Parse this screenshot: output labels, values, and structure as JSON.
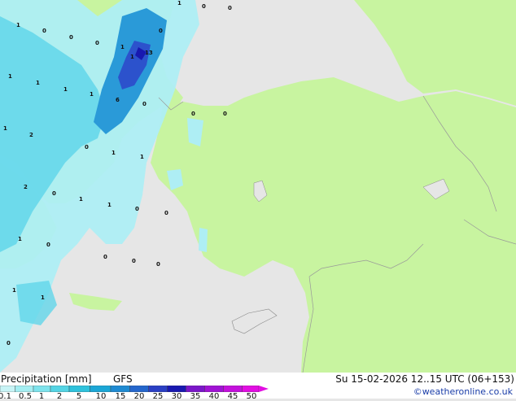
{
  "footer": {
    "title": "Precipitation [mm]",
    "model": "GFS",
    "datetime": "Su 15-02-2026 12..15 UTC (06+153)",
    "credit": "©weatheronline.co.uk"
  },
  "legend": {
    "ticks": [
      "0.1",
      "0.5",
      "1",
      "2",
      "5",
      "10",
      "15",
      "20",
      "25",
      "30",
      "35",
      "40",
      "45",
      "50"
    ],
    "colors": [
      "#c8f4f6",
      "#a4eef2",
      "#7ee3ec",
      "#54d4e4",
      "#2ec2dc",
      "#1aa6d6",
      "#1e8ad2",
      "#2466cc",
      "#2a3fc4",
      "#1818b0",
      "#7a16c8",
      "#a012d4",
      "#c410dc",
      "#e20ee2"
    ]
  },
  "map_values": [
    "1",
    "0",
    "0",
    "0",
    "0",
    "1",
    "0",
    "0",
    "1",
    "1",
    "1",
    "13",
    "1",
    "6",
    "1",
    "0",
    "1",
    "0",
    "0",
    "1",
    "2",
    "0",
    "1",
    "1",
    "2",
    "0",
    "1",
    "1",
    "0",
    "0",
    "1",
    "0",
    "0",
    "0",
    "1",
    "1",
    "0",
    "0"
  ],
  "colors": {
    "land": "#c8f4a0",
    "sea": "#e6e6e6",
    "precip_light": "#aeeef4",
    "precip_mid": "#62d6ea",
    "precip_high": "#2a9ad8",
    "precip_heavy": "#2c52cc"
  }
}
